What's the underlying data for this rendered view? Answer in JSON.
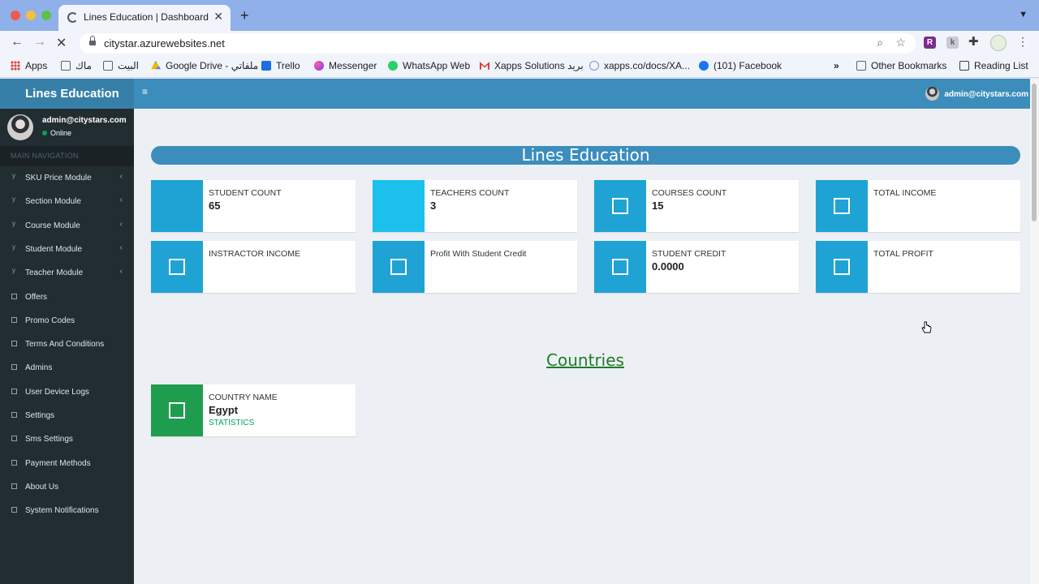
{
  "browser": {
    "tab_title": "Lines Education | Dashboard",
    "url": "citystar.azurewebsites.net",
    "bookmarks": [
      {
        "label": "Apps",
        "icon": "apps-grid-icon"
      },
      {
        "label": "ماك",
        "icon": "folder-icon"
      },
      {
        "label": "البيت",
        "icon": "folder-icon"
      },
      {
        "label": "Google Drive - ملفاتي",
        "icon": "google-drive-icon"
      },
      {
        "label": "Trello",
        "icon": "trello-icon"
      },
      {
        "label": "Messenger",
        "icon": "messenger-icon"
      },
      {
        "label": "WhatsApp Web",
        "icon": "whatsapp-icon"
      },
      {
        "label": "Xapps Solutions بريد",
        "icon": "gmail-icon"
      },
      {
        "label": "xapps.co/docs/XA...",
        "icon": "xapps-icon"
      },
      {
        "label": "(101) Facebook",
        "icon": "facebook-icon"
      }
    ],
    "more_bookmarks": "»",
    "other_bookmarks": "Other Bookmarks",
    "reading_list": "Reading List"
  },
  "header": {
    "logo": "Lines Education",
    "toggle": "≡",
    "user": "admin@citystars.com"
  },
  "sidebar": {
    "user_name": "admin@citystars.com",
    "status": "Online",
    "nav_header": "MAIN NAVIGATION",
    "items": [
      {
        "label": "SKU Price Module",
        "expandable": true
      },
      {
        "label": "Section Module",
        "expandable": true
      },
      {
        "label": "Course Module",
        "expandable": true
      },
      {
        "label": "Student Module",
        "expandable": true
      },
      {
        "label": "Teacher Module",
        "expandable": true
      },
      {
        "label": "Offers",
        "expandable": false
      },
      {
        "label": "Promo Codes",
        "expandable": false
      },
      {
        "label": "Terms And Conditions",
        "expandable": false
      },
      {
        "label": "Admins",
        "expandable": false
      },
      {
        "label": "User Device Logs",
        "expandable": false
      },
      {
        "label": "Settings",
        "expandable": false
      },
      {
        "label": "Sms Settings",
        "expandable": false
      },
      {
        "label": "Payment Methods",
        "expandable": false
      },
      {
        "label": "About Us",
        "expandable": false
      },
      {
        "label": "System Notifications",
        "expandable": false
      }
    ]
  },
  "main": {
    "title": "Lines Education",
    "stats": [
      {
        "label": "STUDENT COUNT",
        "value": "65",
        "color": "#1fa3d4",
        "has_icon": false
      },
      {
        "label": "TEACHERS COUNT",
        "value": "3",
        "color": "#1cc0ed",
        "has_icon": false
      },
      {
        "label": "COURSES COUNT",
        "value": "15",
        "color": "#1fa3d4",
        "has_icon": true
      },
      {
        "label": "TOTAL INCOME",
        "value": "",
        "color": "#1fa3d4",
        "has_icon": true
      },
      {
        "label": "INSTRACTOR INCOME",
        "value": "",
        "color": "#1fa3d4",
        "has_icon": true
      },
      {
        "label": "Profit With Student Credit",
        "value": "",
        "color": "#1fa3d4",
        "has_icon": true
      },
      {
        "label": "STUDENT CREDIT",
        "value": "0.0000",
        "color": "#1fa3d4",
        "has_icon": true
      },
      {
        "label": "TOTAL PROFIT",
        "value": "",
        "color": "#1fa3d4",
        "has_icon": true
      }
    ],
    "countries_title": "Countries",
    "countries": [
      {
        "label": "COUNTRY NAME",
        "name": "Egypt",
        "link": "STATISTICS",
        "color": "#1f9d4f"
      }
    ]
  }
}
